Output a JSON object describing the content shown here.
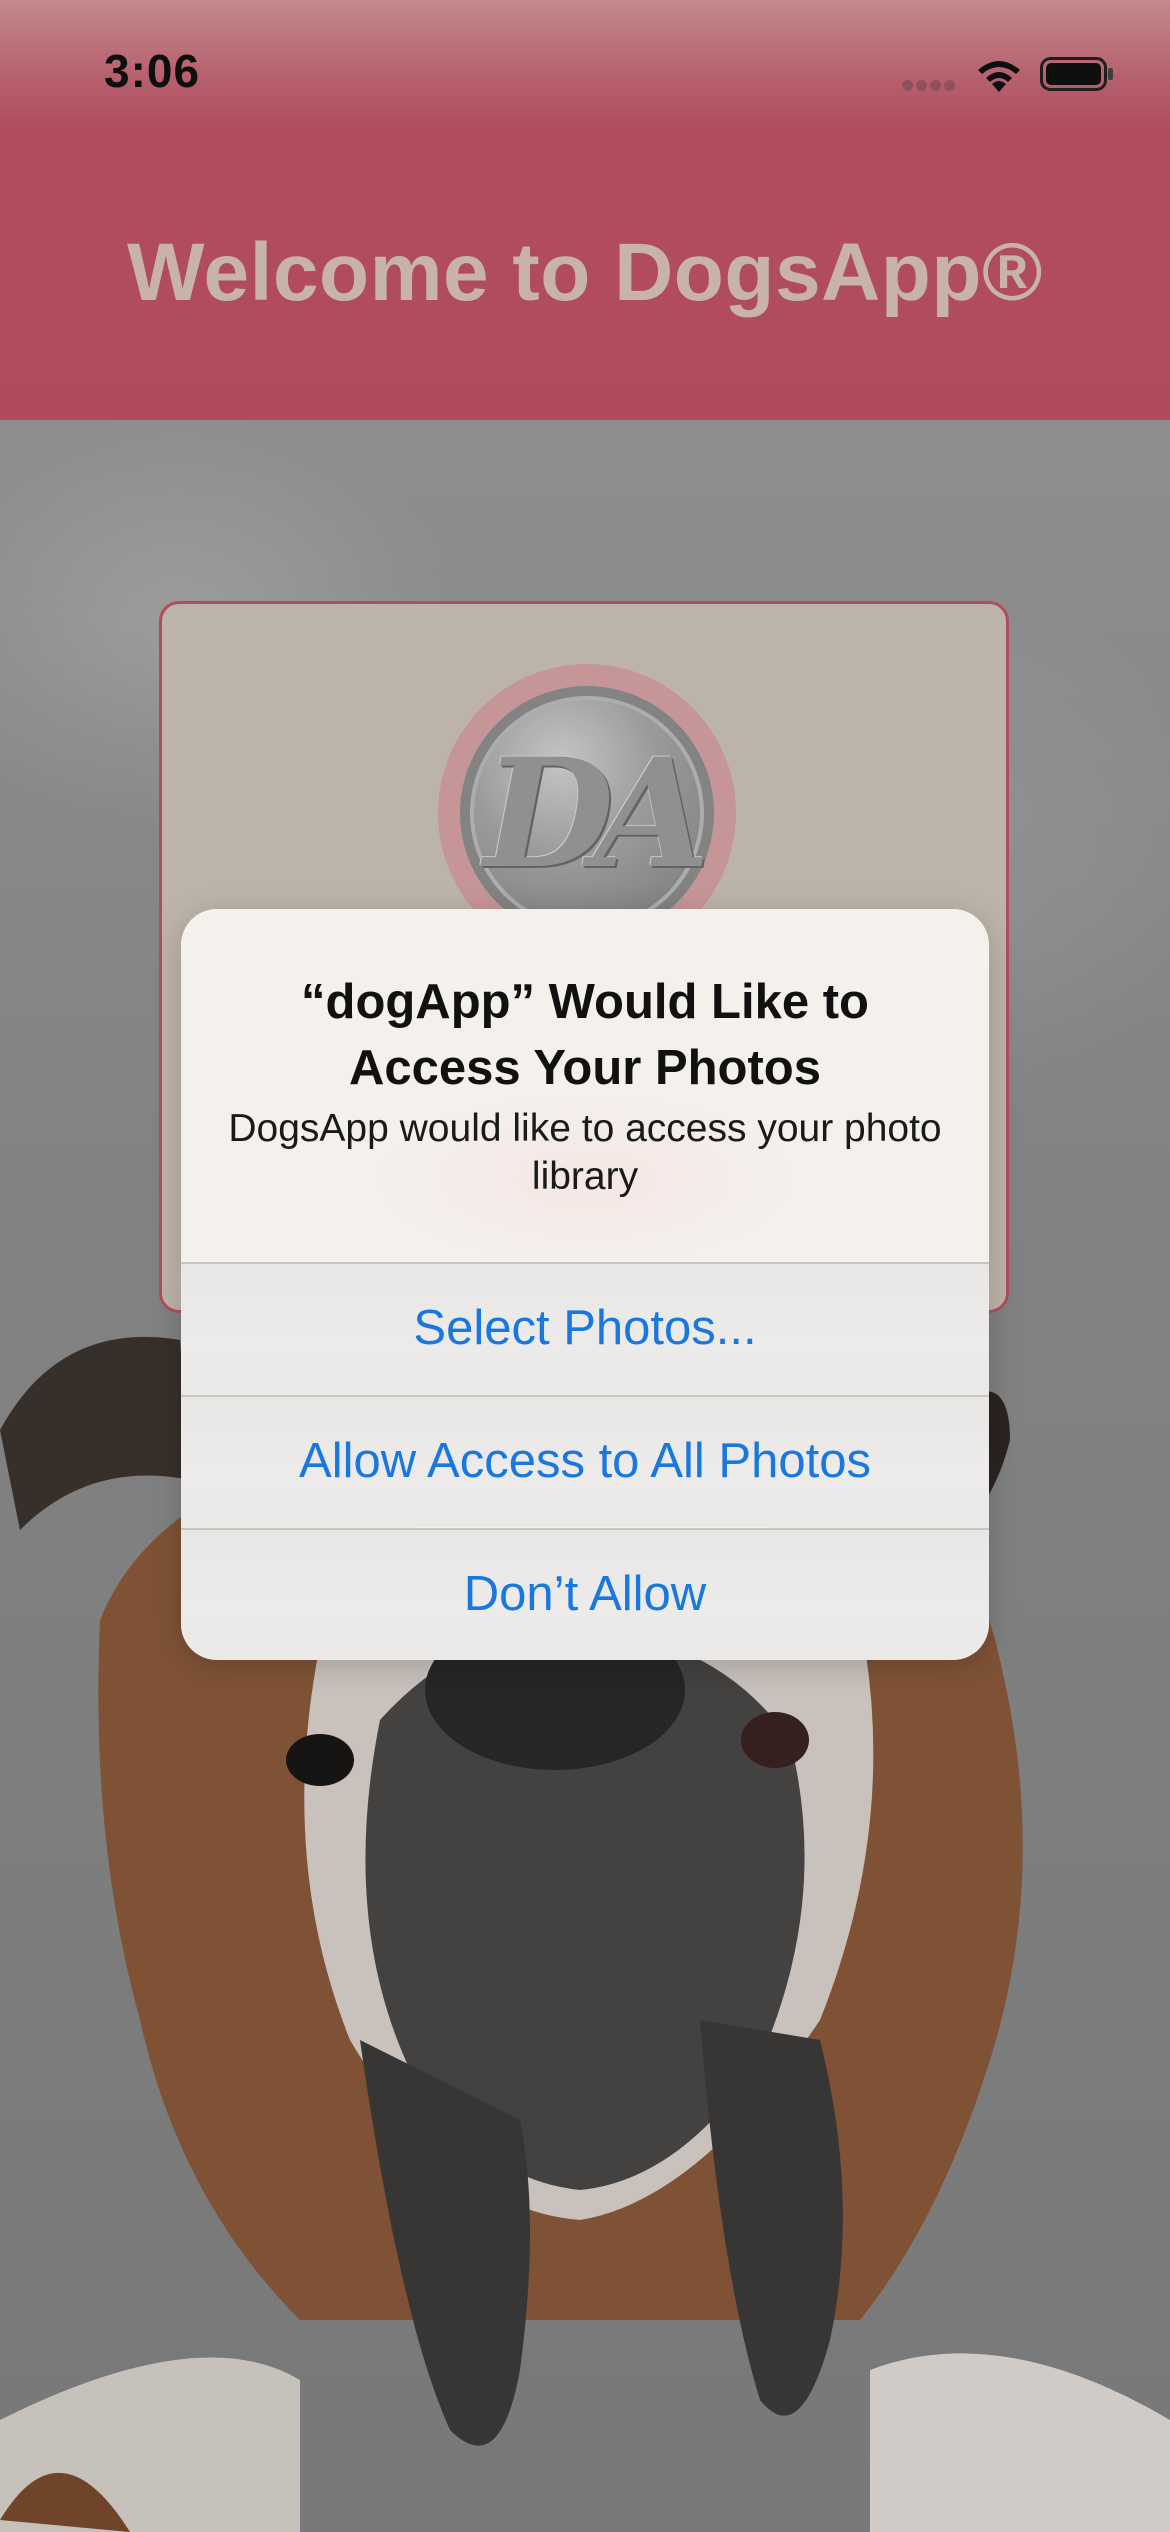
{
  "status_bar": {
    "time": "3:06"
  },
  "header": {
    "title": "Welcome to DogsApp®",
    "background_color": "#bf5266"
  },
  "card": {
    "logo_text": "DA"
  },
  "alert": {
    "title": "“dogApp” Would Like to Access Your Photos",
    "message": "DogsApp would like to access your photo library",
    "buttons": {
      "select_photos": "Select Photos...",
      "allow_all": "Allow Access to All Photos",
      "dont_allow": "Don’t Allow"
    },
    "button_color": "#1977e0"
  },
  "icons": {
    "signal": "signal-dots-icon",
    "wifi": "wifi-icon",
    "battery": "battery-icon"
  }
}
